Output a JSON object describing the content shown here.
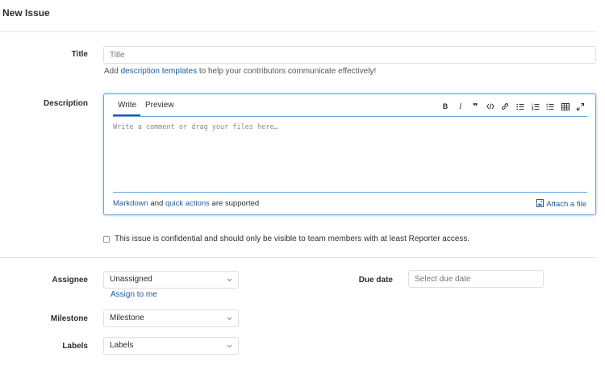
{
  "header": {
    "title": "New Issue"
  },
  "title_field": {
    "label": "Title",
    "placeholder": "Title"
  },
  "templates_hint": {
    "prefix": "Add",
    "link": "description templates",
    "suffix": "to help your contributors communicate effectively!"
  },
  "description": {
    "label": "Description",
    "tabs": [
      {
        "label": "Write",
        "active": true
      },
      {
        "label": "Preview",
        "active": false
      }
    ],
    "toolbar": [
      "bold-icon",
      "italic-icon",
      "quote-icon",
      "code-icon",
      "link-icon",
      "bulleted-list-icon",
      "numbered-list-icon",
      "task-list-icon",
      "table-icon",
      "fullscreen-icon"
    ],
    "placeholder": "Write a comment or drag your files here…",
    "footer_markdown": "Markdown",
    "footer_and": "and",
    "footer_quick_actions": "quick actions",
    "footer_supported": "are supported",
    "attach_label": "Attach a file"
  },
  "confidential": {
    "text": "This issue is confidential and should only be visible to team members with at least Reporter access.",
    "checked": false
  },
  "assignee": {
    "label": "Assignee",
    "value": "Unassigned",
    "assign_to_me": "Assign to me"
  },
  "due_date": {
    "label": "Due date",
    "placeholder": "Select due date"
  },
  "milestone": {
    "label": "Milestone",
    "value": "Milestone"
  },
  "labels": {
    "label": "Labels",
    "value": "Labels"
  },
  "colors": {
    "link": "#1f5a96",
    "accent_border": "#6aa4e0"
  }
}
